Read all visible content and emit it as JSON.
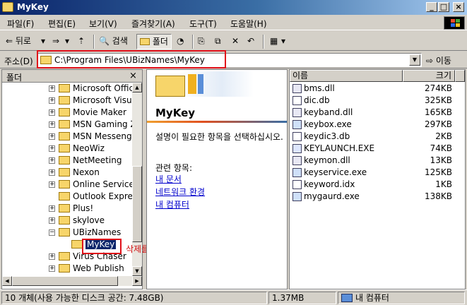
{
  "window": {
    "title": "MyKey",
    "min_glyph": "_",
    "max_glyph": "□",
    "close_glyph": "×"
  },
  "menu": [
    "파일(F)",
    "편집(E)",
    "보기(V)",
    "즐겨찾기(A)",
    "도구(T)",
    "도움말(H)"
  ],
  "toolbar": {
    "back_label": "뒤로",
    "back_glyph": "⇐",
    "dropdown_glyph": "▾",
    "forward_glyph": "⇒",
    "up_glyph": "⇡",
    "search_label": "검색",
    "folders_label": "폴더",
    "history_glyph": "◔",
    "move_glyph": "⎘",
    "copy_glyph": "⧉",
    "delete_glyph": "✕",
    "undo_glyph": "↶",
    "views_glyph": "▦"
  },
  "address": {
    "label": "주소(D)",
    "path": "C:\\Program Files\\UBizNames\\MyKey",
    "drop_glyph": "▼",
    "go_label": "이동",
    "go_glyph": "⇨"
  },
  "folders_panel": {
    "title": "폴더",
    "close_glyph": "×",
    "items": [
      {
        "label": "Microsoft Office",
        "expandable": true
      },
      {
        "label": "Microsoft Visual",
        "expandable": true
      },
      {
        "label": "Movie Maker",
        "expandable": true
      },
      {
        "label": "MSN Gaming Zone",
        "expandable": true
      },
      {
        "label": "MSN Messenger",
        "expandable": true
      },
      {
        "label": "NeoWiz",
        "expandable": true
      },
      {
        "label": "NetMeeting",
        "expandable": true
      },
      {
        "label": "Nexon",
        "expandable": true
      },
      {
        "label": "Online Services",
        "expandable": true
      },
      {
        "label": "Outlook Express",
        "expandable": false
      },
      {
        "label": "Plus!",
        "expandable": true
      },
      {
        "label": "skylove",
        "expandable": true
      },
      {
        "label": "UBizNames",
        "expandable": true,
        "expanded": true
      },
      {
        "label": "MyKey",
        "expandable": false,
        "selected": true,
        "child": true
      },
      {
        "label": "Virus Chaser",
        "expandable": true
      },
      {
        "label": "Web Publish",
        "expandable": true
      }
    ],
    "scroll_up": "▲",
    "scroll_down": "▼",
    "scroll_left": "◀",
    "scroll_right": "▶",
    "plus_glyph": "+",
    "minus_glyph": "−"
  },
  "annotation": "삭제를 합니다",
  "webview": {
    "folder_name": "MyKey",
    "description": "설명이 필요한 항목을 선택하십시오.",
    "related_label": "관련 항목:",
    "links": [
      "내 문서",
      "네트워크 환경",
      "내 컴퓨터"
    ]
  },
  "file_list": {
    "columns": {
      "name": "이름",
      "size": "크기"
    },
    "files": [
      {
        "name": "bms.dll",
        "size": "274KB"
      },
      {
        "name": "dic.db",
        "size": "325KB"
      },
      {
        "name": "keyband.dll",
        "size": "165KB"
      },
      {
        "name": "keybox.exe",
        "size": "297KB"
      },
      {
        "name": "keydic3.db",
        "size": "2KB"
      },
      {
        "name": "KEYLAUNCH.EXE",
        "size": "74KB"
      },
      {
        "name": "keymon.dll",
        "size": "13KB"
      },
      {
        "name": "keyservice.exe",
        "size": "125KB"
      },
      {
        "name": "keyword.idx",
        "size": "1KB"
      },
      {
        "name": "mygaurd.exe",
        "size": "138KB"
      }
    ]
  },
  "status": {
    "objects": "10 개체(사용 가능한 디스크 공간: 7.48GB)",
    "size": "1.37MB",
    "zone": "내 컴퓨터"
  },
  "colors": {
    "highlight_red": "#e0101a",
    "selection_blue": "#0a246a",
    "link": "#0000cc"
  }
}
